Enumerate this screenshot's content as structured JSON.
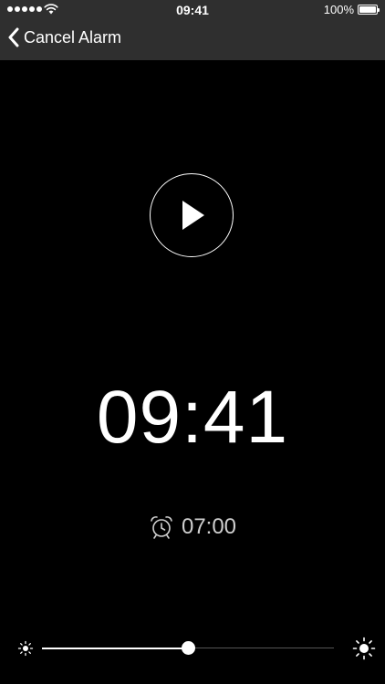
{
  "status_bar": {
    "time": "09:41",
    "battery_percent_label": "100%",
    "battery_level": 1.0,
    "signal_bars": 5
  },
  "nav": {
    "back_label": "Cancel Alarm",
    "back_icon": "chevron-left-icon"
  },
  "player": {
    "play_icon": "play-icon"
  },
  "clock": {
    "current_time": "09:41"
  },
  "alarm": {
    "icon": "alarm-clock-icon",
    "time": "07:00"
  },
  "brightness": {
    "min_icon": "sun-small-icon",
    "max_icon": "sun-large-icon",
    "level": 0.5
  },
  "colors": {
    "background": "#000000",
    "header_background": "#2f2f2f",
    "foreground": "#ffffff",
    "alarm_text": "#cfcfcf",
    "slider_track": "#555555"
  }
}
